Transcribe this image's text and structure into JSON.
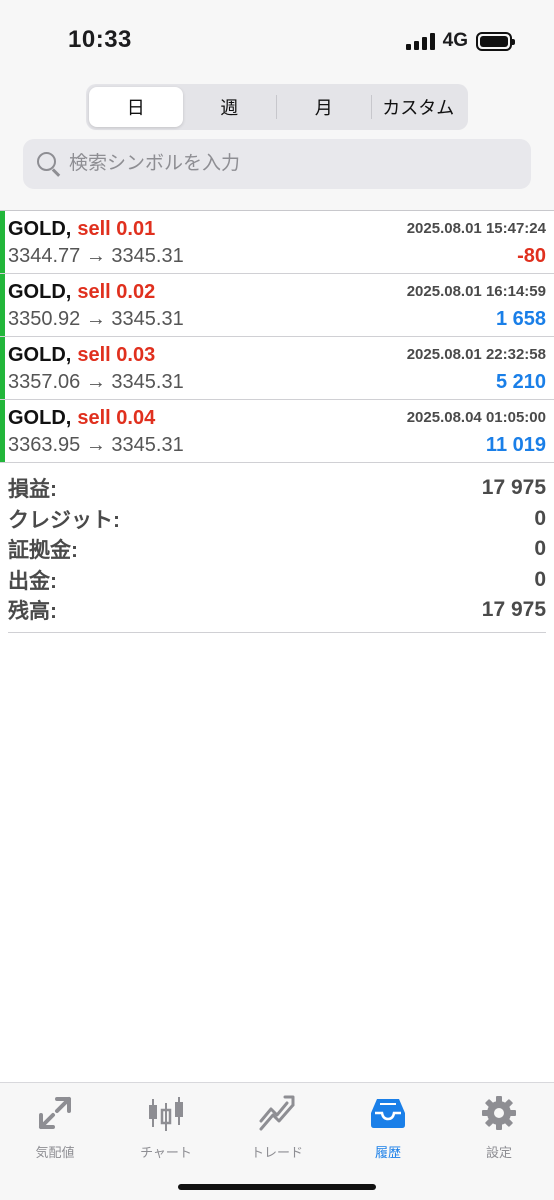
{
  "status_bar": {
    "time": "10:33",
    "network": "4G"
  },
  "period_tabs": {
    "items": [
      {
        "label": "日",
        "active": true
      },
      {
        "label": "週",
        "active": false
      },
      {
        "label": "月",
        "active": false
      },
      {
        "label": "カスタム",
        "active": false
      }
    ]
  },
  "search": {
    "placeholder": "検索シンボルを入力",
    "icon": "search-icon"
  },
  "trades": [
    {
      "symbol": "GOLD,",
      "side": "sell 0.01",
      "datetime": "2025.08.01 15:47:24",
      "prices": "3344.77 → 3345.31",
      "profit": "-80",
      "profit_sign": "negative"
    },
    {
      "symbol": "GOLD,",
      "side": "sell 0.02",
      "datetime": "2025.08.01 16:14:59",
      "prices": "3350.92 → 3345.31",
      "profit": "1 658",
      "profit_sign": "positive"
    },
    {
      "symbol": "GOLD,",
      "side": "sell 0.03",
      "datetime": "2025.08.01 22:32:58",
      "prices": "3357.06 → 3345.31",
      "profit": "5 210",
      "profit_sign": "positive"
    },
    {
      "symbol": "GOLD,",
      "side": "sell 0.04",
      "datetime": "2025.08.04 01:05:00",
      "prices": "3363.95 → 3345.31",
      "profit": "11 019",
      "profit_sign": "positive"
    }
  ],
  "summary": [
    {
      "label": "損益:",
      "value": "17 975"
    },
    {
      "label": "クレジット:",
      "value": "0"
    },
    {
      "label": "証拠金:",
      "value": "0"
    },
    {
      "label": "出金:",
      "value": "0"
    },
    {
      "label": "残高:",
      "value": "17 975"
    }
  ],
  "tab_bar": {
    "items": [
      {
        "label": "気配値",
        "icon": "quotes-arrows-icon",
        "active": false
      },
      {
        "label": "チャート",
        "icon": "candlestick-icon",
        "active": false
      },
      {
        "label": "トレード",
        "icon": "trade-chart-icon",
        "active": false
      },
      {
        "label": "履歴",
        "icon": "inbox-tray-icon",
        "active": true
      },
      {
        "label": "設定",
        "icon": "gear-icon",
        "active": false
      }
    ]
  },
  "colors": {
    "buy_bar": "#22b63a",
    "sell_text": "#e0301e",
    "profit_positive": "#1a7fe8",
    "profit_negative": "#e0301e",
    "tab_active": "#1a7fe8",
    "tab_inactive": "#8e8e93"
  }
}
